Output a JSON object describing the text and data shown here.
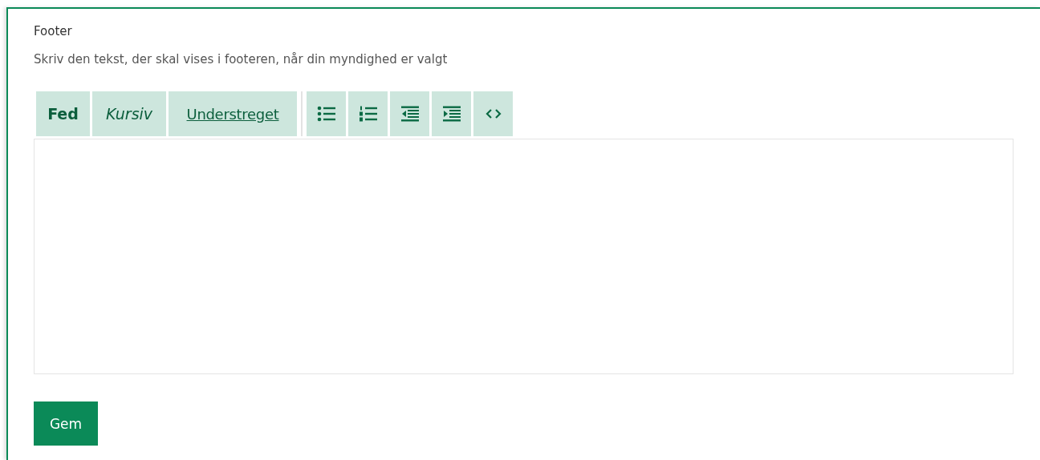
{
  "section": {
    "title": "Footer",
    "description": "Skriv den tekst, der skal vises i footeren, når din myndighed er valgt"
  },
  "toolbar": {
    "groups": [
      {
        "buttons": [
          {
            "kind": "bold",
            "label": "Fed"
          },
          {
            "kind": "italic",
            "label": "Kursiv"
          },
          {
            "kind": "underline",
            "label": "Understreget"
          }
        ]
      },
      {
        "buttons": [
          {
            "kind": "bullet-list"
          },
          {
            "kind": "numbered-list"
          },
          {
            "kind": "outdent"
          },
          {
            "kind": "indent"
          },
          {
            "kind": "code"
          }
        ]
      }
    ]
  },
  "save_button": {
    "label": "Gem"
  }
}
